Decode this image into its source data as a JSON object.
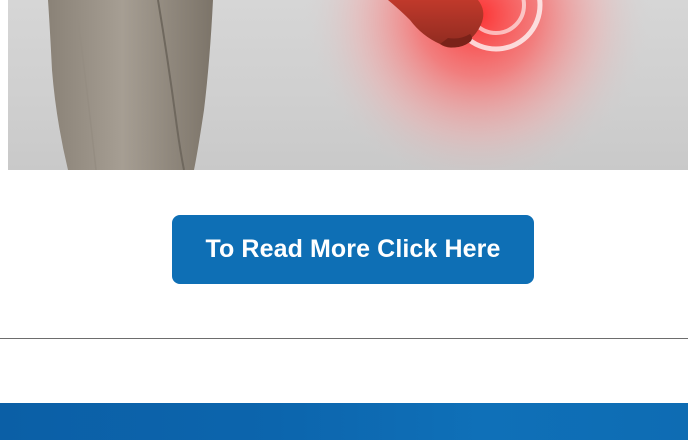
{
  "hero": {
    "image_alt": "Person holding hand with red pain highlight",
    "accent_color": "#ff4d4d"
  },
  "cta": {
    "label": "To Read More Click Here",
    "background": "#0e6fb5",
    "text_color": "#ffffff"
  },
  "footer": {
    "background": "#0c65ad"
  }
}
